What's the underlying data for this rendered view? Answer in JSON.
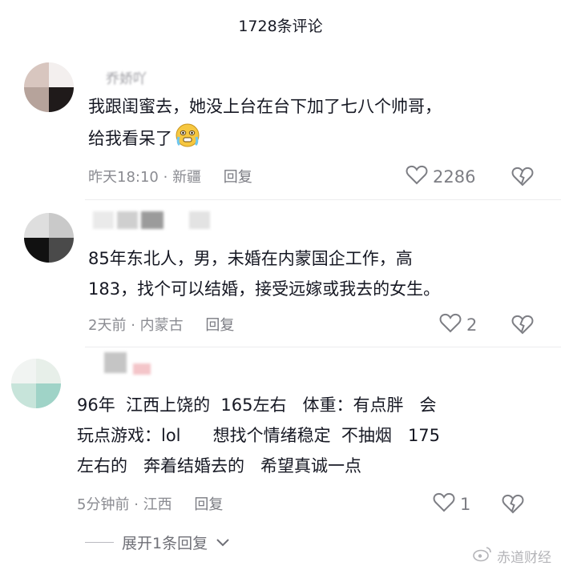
{
  "header": {
    "title": "1728条评论"
  },
  "comments": [
    {
      "username": "乔娇吖",
      "text_lines": [
        "我跟闺蜜去，她没上台在台下加了七八个帅哥，",
        "给我看呆了"
      ],
      "time": "昨天18:10",
      "location": "新疆",
      "reply_label": "回复",
      "likes": "2286"
    },
    {
      "username": "",
      "text_lines": [
        "85年东北人，男，未婚在内蒙国企工作，高",
        "183，找个可以结婚，接受远嫁或我去的女生。"
      ],
      "time": "2天前",
      "location": "内蒙古",
      "reply_label": "回复",
      "likes": "2"
    },
    {
      "username": "",
      "text_lines": [
        "96年  江西上饶的  165左右   体重：有点胖   会",
        "玩点游戏：lol      想找个情绪稳定  不抽烟   175",
        "左右的   奔着结婚去的   希望真诚一点"
      ],
      "time": "5分钟前",
      "location": "江西",
      "reply_label": "回复",
      "likes": "1"
    }
  ],
  "expand": {
    "label": "展开1条回复"
  },
  "watermark": {
    "text": "赤道财经"
  },
  "icons": {
    "like": "heart-outline-icon",
    "dislike": "broken-heart-icon",
    "emoji": "crying-face-icon",
    "expand": "chevron-down-icon"
  }
}
